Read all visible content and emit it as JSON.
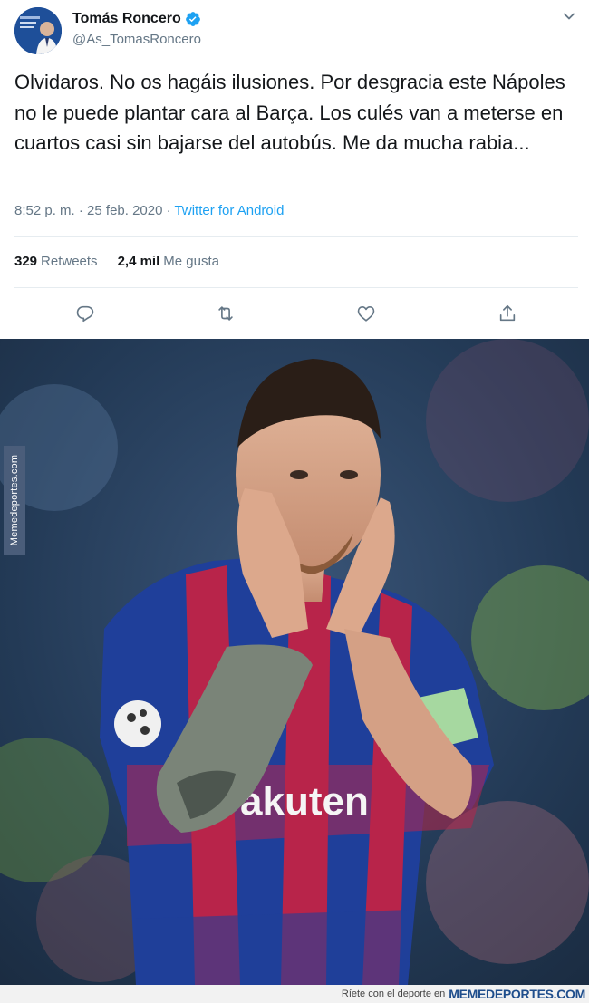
{
  "tweet": {
    "display_name": "Tomás Roncero",
    "handle": "@As_TomasRoncero",
    "verified": true,
    "text": "Olvidaros. No os hagáis ilusiones. Por desgracia este Nápoles no le puede plantar cara al Barça. Los culés van a meterse en cuartos casi sin bajarse del autobús. Me da mucha rabia...",
    "time": "8:52 p. m.",
    "separator": " · ",
    "date": "25 feb. 2020",
    "source": "Twitter for Android",
    "retweets_count": "329",
    "retweets_label": "Retweets",
    "likes_count": "2,4 mil",
    "likes_label": "Me gusta"
  },
  "actions": {
    "icons": [
      "reply-icon",
      "retweet-icon",
      "like-icon",
      "share-icon"
    ]
  },
  "colors": {
    "link": "#1da1f2",
    "secondary": "#657786",
    "primary_text": "#14171a"
  },
  "watermark": {
    "side_text": "Memedeportes.com",
    "footer_text": "Ríete con el deporte en",
    "footer_brand": "MEMEDEPORTES.COM"
  }
}
